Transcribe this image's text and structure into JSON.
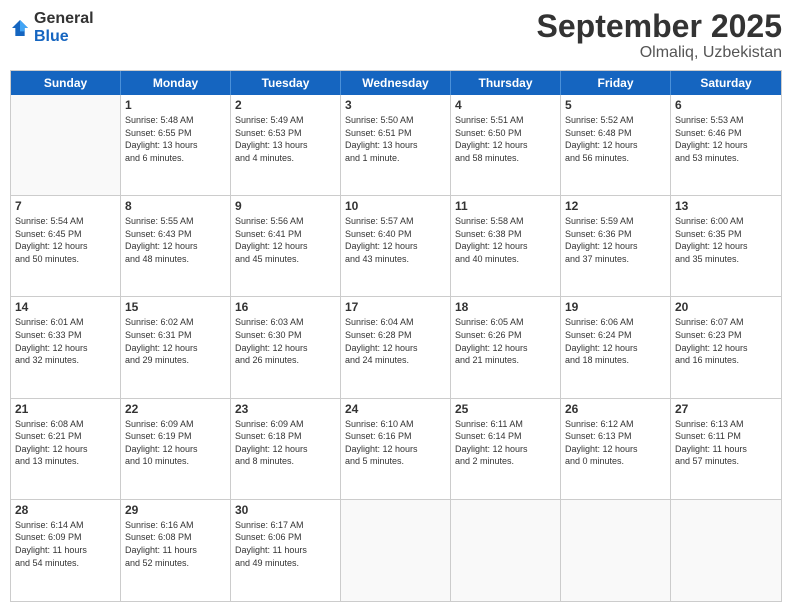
{
  "header": {
    "logo_general": "General",
    "logo_blue": "Blue",
    "month_title": "September 2025",
    "location": "Olmaliq, Uzbekistan"
  },
  "calendar": {
    "days_of_week": [
      "Sunday",
      "Monday",
      "Tuesday",
      "Wednesday",
      "Thursday",
      "Friday",
      "Saturday"
    ],
    "weeks": [
      [
        {
          "day": "",
          "info": ""
        },
        {
          "day": "1",
          "info": "Sunrise: 5:48 AM\nSunset: 6:55 PM\nDaylight: 13 hours\nand 6 minutes."
        },
        {
          "day": "2",
          "info": "Sunrise: 5:49 AM\nSunset: 6:53 PM\nDaylight: 13 hours\nand 4 minutes."
        },
        {
          "day": "3",
          "info": "Sunrise: 5:50 AM\nSunset: 6:51 PM\nDaylight: 13 hours\nand 1 minute."
        },
        {
          "day": "4",
          "info": "Sunrise: 5:51 AM\nSunset: 6:50 PM\nDaylight: 12 hours\nand 58 minutes."
        },
        {
          "day": "5",
          "info": "Sunrise: 5:52 AM\nSunset: 6:48 PM\nDaylight: 12 hours\nand 56 minutes."
        },
        {
          "day": "6",
          "info": "Sunrise: 5:53 AM\nSunset: 6:46 PM\nDaylight: 12 hours\nand 53 minutes."
        }
      ],
      [
        {
          "day": "7",
          "info": "Sunrise: 5:54 AM\nSunset: 6:45 PM\nDaylight: 12 hours\nand 50 minutes."
        },
        {
          "day": "8",
          "info": "Sunrise: 5:55 AM\nSunset: 6:43 PM\nDaylight: 12 hours\nand 48 minutes."
        },
        {
          "day": "9",
          "info": "Sunrise: 5:56 AM\nSunset: 6:41 PM\nDaylight: 12 hours\nand 45 minutes."
        },
        {
          "day": "10",
          "info": "Sunrise: 5:57 AM\nSunset: 6:40 PM\nDaylight: 12 hours\nand 43 minutes."
        },
        {
          "day": "11",
          "info": "Sunrise: 5:58 AM\nSunset: 6:38 PM\nDaylight: 12 hours\nand 40 minutes."
        },
        {
          "day": "12",
          "info": "Sunrise: 5:59 AM\nSunset: 6:36 PM\nDaylight: 12 hours\nand 37 minutes."
        },
        {
          "day": "13",
          "info": "Sunrise: 6:00 AM\nSunset: 6:35 PM\nDaylight: 12 hours\nand 35 minutes."
        }
      ],
      [
        {
          "day": "14",
          "info": "Sunrise: 6:01 AM\nSunset: 6:33 PM\nDaylight: 12 hours\nand 32 minutes."
        },
        {
          "day": "15",
          "info": "Sunrise: 6:02 AM\nSunset: 6:31 PM\nDaylight: 12 hours\nand 29 minutes."
        },
        {
          "day": "16",
          "info": "Sunrise: 6:03 AM\nSunset: 6:30 PM\nDaylight: 12 hours\nand 26 minutes."
        },
        {
          "day": "17",
          "info": "Sunrise: 6:04 AM\nSunset: 6:28 PM\nDaylight: 12 hours\nand 24 minutes."
        },
        {
          "day": "18",
          "info": "Sunrise: 6:05 AM\nSunset: 6:26 PM\nDaylight: 12 hours\nand 21 minutes."
        },
        {
          "day": "19",
          "info": "Sunrise: 6:06 AM\nSunset: 6:24 PM\nDaylight: 12 hours\nand 18 minutes."
        },
        {
          "day": "20",
          "info": "Sunrise: 6:07 AM\nSunset: 6:23 PM\nDaylight: 12 hours\nand 16 minutes."
        }
      ],
      [
        {
          "day": "21",
          "info": "Sunrise: 6:08 AM\nSunset: 6:21 PM\nDaylight: 12 hours\nand 13 minutes."
        },
        {
          "day": "22",
          "info": "Sunrise: 6:09 AM\nSunset: 6:19 PM\nDaylight: 12 hours\nand 10 minutes."
        },
        {
          "day": "23",
          "info": "Sunrise: 6:09 AM\nSunset: 6:18 PM\nDaylight: 12 hours\nand 8 minutes."
        },
        {
          "day": "24",
          "info": "Sunrise: 6:10 AM\nSunset: 6:16 PM\nDaylight: 12 hours\nand 5 minutes."
        },
        {
          "day": "25",
          "info": "Sunrise: 6:11 AM\nSunset: 6:14 PM\nDaylight: 12 hours\nand 2 minutes."
        },
        {
          "day": "26",
          "info": "Sunrise: 6:12 AM\nSunset: 6:13 PM\nDaylight: 12 hours\nand 0 minutes."
        },
        {
          "day": "27",
          "info": "Sunrise: 6:13 AM\nSunset: 6:11 PM\nDaylight: 11 hours\nand 57 minutes."
        }
      ],
      [
        {
          "day": "28",
          "info": "Sunrise: 6:14 AM\nSunset: 6:09 PM\nDaylight: 11 hours\nand 54 minutes."
        },
        {
          "day": "29",
          "info": "Sunrise: 6:16 AM\nSunset: 6:08 PM\nDaylight: 11 hours\nand 52 minutes."
        },
        {
          "day": "30",
          "info": "Sunrise: 6:17 AM\nSunset: 6:06 PM\nDaylight: 11 hours\nand 49 minutes."
        },
        {
          "day": "",
          "info": ""
        },
        {
          "day": "",
          "info": ""
        },
        {
          "day": "",
          "info": ""
        },
        {
          "day": "",
          "info": ""
        }
      ]
    ]
  }
}
